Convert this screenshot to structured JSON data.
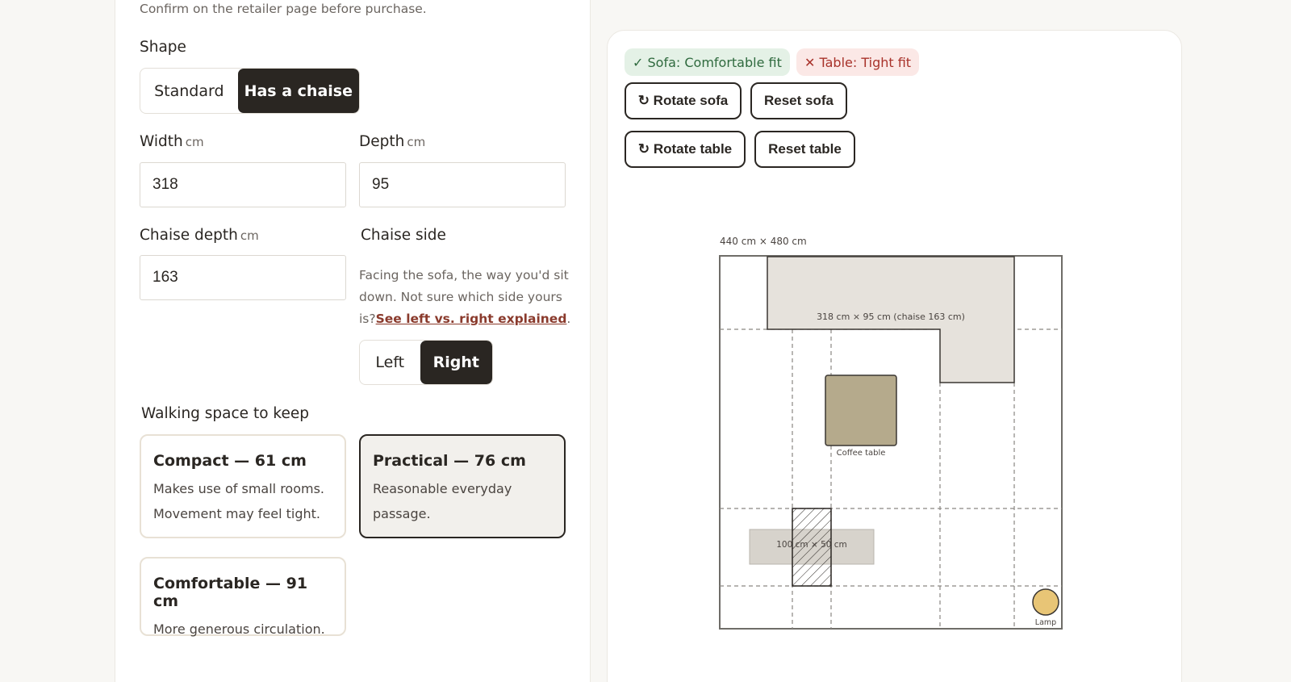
{
  "note": "Confirm on the retailer page before purchase.",
  "shape": {
    "label": "Shape",
    "options": [
      "Standard",
      "Has a chaise"
    ],
    "selected": "Has a chaise"
  },
  "width": {
    "label": "Width",
    "unit": "cm",
    "value": "318"
  },
  "depth": {
    "label": "Depth",
    "unit": "cm",
    "value": "95"
  },
  "chaise_depth": {
    "label": "Chaise depth",
    "unit": "cm",
    "value": "163"
  },
  "chaise_side": {
    "label": "Chaise side",
    "hint": "Facing the sofa, the way you'd sit down. Not sure which side yours is?",
    "link": "See left vs. right explained",
    "options": [
      "Left",
      "Right"
    ],
    "selected": "Right"
  },
  "walking": {
    "label": "Walking space to keep",
    "options": [
      {
        "title": "Compact — 61 cm",
        "desc": "Makes use of small rooms. Movement may feel tight."
      },
      {
        "title": "Practical — 76 cm",
        "desc": "Reasonable everyday passage."
      },
      {
        "title": "Comfortable — 91 cm",
        "desc": "More generous circulation."
      }
    ],
    "selected": "Practical — 76 cm"
  },
  "status": {
    "sofa": "✓ Sofa: Comfortable fit",
    "table": "✕ Table: Tight fit",
    "ok_color": "#2f6a3e",
    "bad_color": "#a8322a"
  },
  "actions": {
    "rotate_sofa": "↻ Rotate sofa",
    "reset_sofa": "Reset sofa",
    "rotate_table": "↻ Rotate table",
    "reset_table": "Reset table"
  },
  "plan": {
    "room_label": "440 cm × 480 cm",
    "sofa_label": "318 cm × 95 cm (chaise 163 cm)",
    "table_label": "Coffee table",
    "item_label": "100 cm × 50 cm",
    "lamp_label": "Lamp"
  }
}
